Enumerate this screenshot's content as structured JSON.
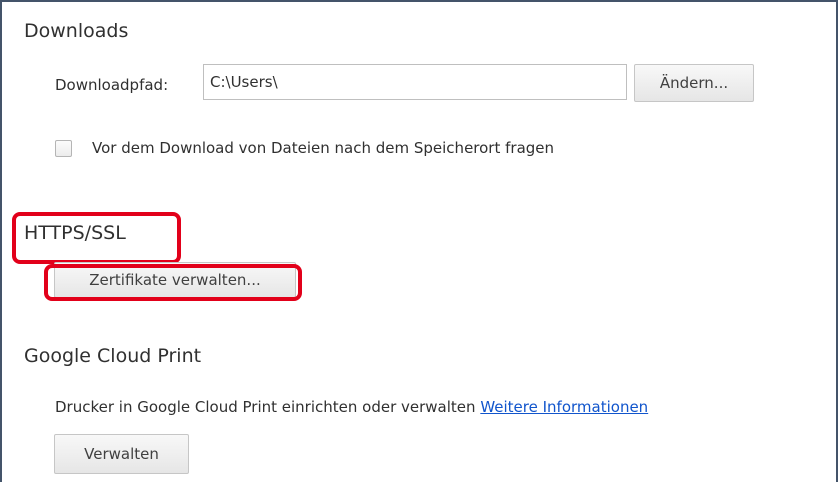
{
  "downloads": {
    "title": "Downloads",
    "path_label": "Downloadpfad:",
    "path_value": "C:\\Users\\",
    "change_button": "Ändern...",
    "ask_checkbox_label": "Vor dem Download von Dateien nach dem Speicherort fragen",
    "ask_checkbox_checked": false
  },
  "https_ssl": {
    "title": "HTTPS/SSL",
    "manage_certificates_button": "Zertifikate verwalten..."
  },
  "cloud_print": {
    "title": "Google Cloud Print",
    "description": "Drucker in Google Cloud Print einrichten oder verwalten",
    "more_info_link": "Weitere Informationen",
    "manage_button": "Verwalten"
  },
  "colors": {
    "highlight": "#e2001a",
    "link": "#1155cc",
    "frame": "#44546a"
  }
}
